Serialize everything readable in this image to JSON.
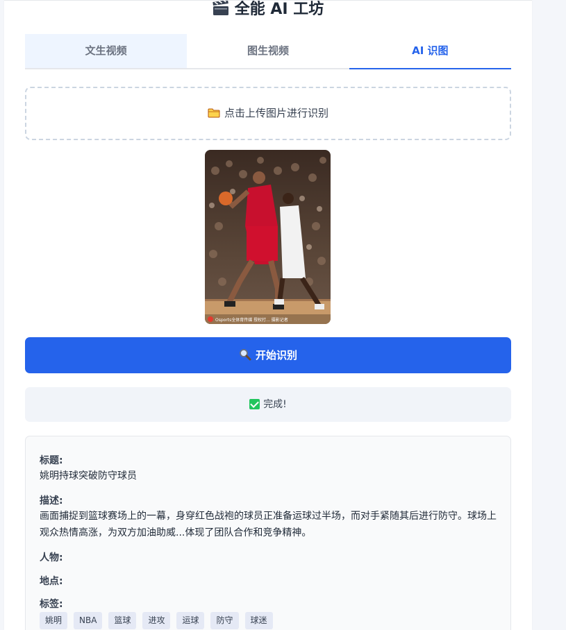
{
  "app": {
    "title": "全能 AI 工坊",
    "title_icon": "clapperboard-icon"
  },
  "tabs": [
    {
      "label": "文生视频",
      "active": false
    },
    {
      "label": "图生视频",
      "active": false
    },
    {
      "label": "AI 识图",
      "active": true
    }
  ],
  "upload": {
    "icon": "folder-icon",
    "label": "点击上传图片进行识别"
  },
  "preview": {
    "watermark": "Osports全体育传媒 授权打... 摄影记者"
  },
  "actions": {
    "start_label": "开始识别",
    "start_icon": "magnifier-icon"
  },
  "status": {
    "icon": "check-icon",
    "text": "完成!"
  },
  "result": {
    "title_label": "标题:",
    "title_value": "姚明持球突破防守球员",
    "desc_label": "描述:",
    "desc_value": "画面捕捉到篮球赛场上的一幕，身穿红色战袍的球员正准备运球过半场，而对手紧随其后进行防守。球场上观众热情高涨，为双方加油助威...体现了团队合作和竞争精神。",
    "people_label": "人物:",
    "place_label": "地点:",
    "tags_label": "标签:",
    "tags": [
      "姚明",
      "NBA",
      "篮球",
      "进攻",
      "运球",
      "防守",
      "球迷"
    ]
  },
  "colors": {
    "accent": "#2563eb",
    "active_tab_bg": "#eef5ff",
    "success": "#22c55e"
  }
}
